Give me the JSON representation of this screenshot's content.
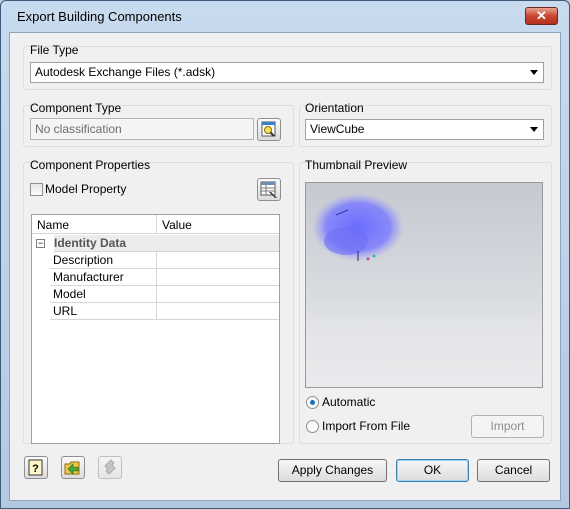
{
  "window": {
    "title": "Export Building Components",
    "close_glyph": "✕"
  },
  "file_type": {
    "label": "File Type",
    "selected": "Autodesk Exchange Files (*.adsk)"
  },
  "component_type": {
    "label": "Component Type",
    "value": "No classification"
  },
  "orientation": {
    "label": "Orientation",
    "selected": "ViewCube"
  },
  "component_properties": {
    "label": "Component Properties",
    "model_property_label": "Model Property",
    "model_property_checked": false,
    "columns": [
      "Name",
      "Value"
    ],
    "category": "Identity Data",
    "category_expander": "−",
    "rows": [
      {
        "name": "Description",
        "value": ""
      },
      {
        "name": "Manufacturer",
        "value": ""
      },
      {
        "name": "Model",
        "value": ""
      },
      {
        "name": "URL",
        "value": ""
      }
    ]
  },
  "thumbnail": {
    "label": "Thumbnail Preview",
    "options": [
      "Automatic",
      "Import From File"
    ],
    "selected": "Automatic",
    "import_label": "Import"
  },
  "footer": {
    "apply_label": "Apply Changes",
    "ok_label": "OK",
    "cancel_label": "Cancel"
  },
  "icons": {
    "help": "help-icon",
    "open": "open-folder-icon",
    "plugin": "plugin-icon",
    "browse": "browse-search-icon",
    "table_edit": "table-edit-icon"
  }
}
